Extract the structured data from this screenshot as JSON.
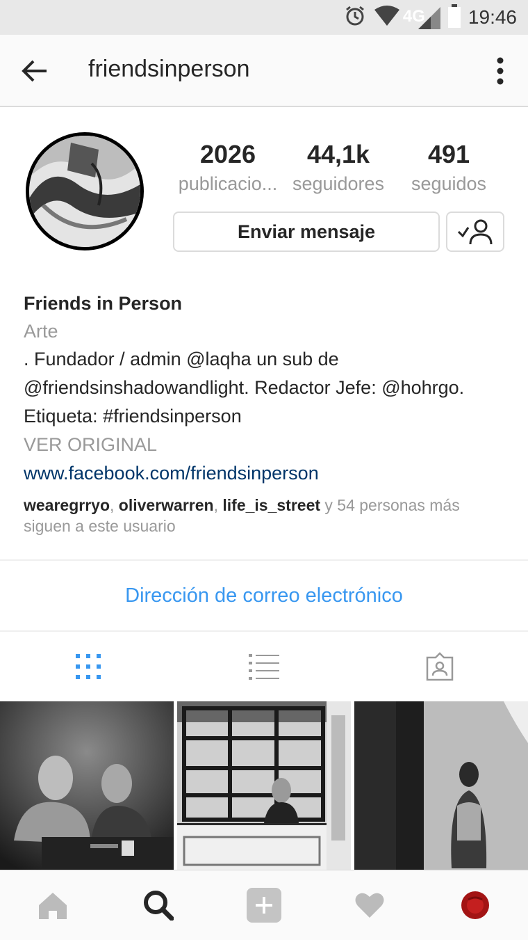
{
  "status_bar": {
    "time": "19:46",
    "network": "4G",
    "icons": [
      "alarm-icon",
      "wifi-icon",
      "signal-icon",
      "battery-icon"
    ]
  },
  "header": {
    "username": "friendsinperson",
    "back_icon": "arrow-left-icon",
    "menu_icon": "more-vertical-icon"
  },
  "profile": {
    "stats": [
      {
        "value": "2026",
        "label": "publicacio..."
      },
      {
        "value": "44,1k",
        "label": "seguidores"
      },
      {
        "value": "491",
        "label": "seguidos"
      }
    ],
    "message_button": "Enviar mensaje",
    "follow_state_icon": "following-check-icon"
  },
  "bio": {
    "name": "Friends in Person",
    "category": "Arte",
    "lines": [
      ". Fundador / admin @laqha un sub de",
      "@friendsinshadowandlight. Redactor Jefe: @hohrgo.",
      "Etiqueta: #friendsinperson"
    ],
    "translate": "VER ORIGINAL",
    "website": "www.facebook.com/friendsinperson",
    "followed_by": {
      "users": [
        "wearegrryo",
        "oliverwarren",
        "life_is_street"
      ],
      "separator": ", ",
      "suffix_1": " y 54 personas más",
      "suffix_2": "siguen a este usuario"
    }
  },
  "contact": {
    "email_label": "Dirección de correo electrónico"
  },
  "tabs": [
    {
      "icon": "grid-icon",
      "active": true
    },
    {
      "icon": "list-icon",
      "active": false
    },
    {
      "icon": "tagged-icon",
      "active": false
    }
  ],
  "posts": [
    {
      "alt": "two-men-photo"
    },
    {
      "alt": "window-portrait-photo"
    },
    {
      "alt": "woman-doorway-photo"
    }
  ],
  "bottom_nav": [
    "home-icon",
    "search-icon",
    "add-icon",
    "heart-icon",
    "profile-avatar-icon"
  ],
  "colors": {
    "accent": "#3897f0",
    "link": "#003569",
    "muted": "#999999",
    "text": "#262626"
  }
}
